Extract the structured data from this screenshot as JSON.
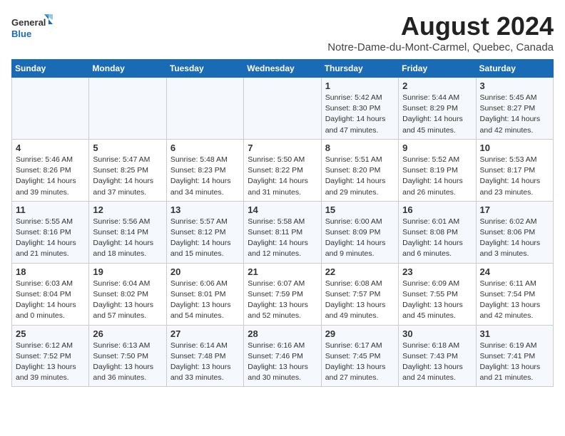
{
  "logo": {
    "line1": "General",
    "line2": "Blue"
  },
  "title": "August 2024",
  "subtitle": "Notre-Dame-du-Mont-Carmel, Quebec, Canada",
  "days_of_week": [
    "Sunday",
    "Monday",
    "Tuesday",
    "Wednesday",
    "Thursday",
    "Friday",
    "Saturday"
  ],
  "weeks": [
    [
      {
        "day": "",
        "info": ""
      },
      {
        "day": "",
        "info": ""
      },
      {
        "day": "",
        "info": ""
      },
      {
        "day": "",
        "info": ""
      },
      {
        "day": "1",
        "info": "Sunrise: 5:42 AM\nSunset: 8:30 PM\nDaylight: 14 hours\nand 47 minutes."
      },
      {
        "day": "2",
        "info": "Sunrise: 5:44 AM\nSunset: 8:29 PM\nDaylight: 14 hours\nand 45 minutes."
      },
      {
        "day": "3",
        "info": "Sunrise: 5:45 AM\nSunset: 8:27 PM\nDaylight: 14 hours\nand 42 minutes."
      }
    ],
    [
      {
        "day": "4",
        "info": "Sunrise: 5:46 AM\nSunset: 8:26 PM\nDaylight: 14 hours\nand 39 minutes."
      },
      {
        "day": "5",
        "info": "Sunrise: 5:47 AM\nSunset: 8:25 PM\nDaylight: 14 hours\nand 37 minutes."
      },
      {
        "day": "6",
        "info": "Sunrise: 5:48 AM\nSunset: 8:23 PM\nDaylight: 14 hours\nand 34 minutes."
      },
      {
        "day": "7",
        "info": "Sunrise: 5:50 AM\nSunset: 8:22 PM\nDaylight: 14 hours\nand 31 minutes."
      },
      {
        "day": "8",
        "info": "Sunrise: 5:51 AM\nSunset: 8:20 PM\nDaylight: 14 hours\nand 29 minutes."
      },
      {
        "day": "9",
        "info": "Sunrise: 5:52 AM\nSunset: 8:19 PM\nDaylight: 14 hours\nand 26 minutes."
      },
      {
        "day": "10",
        "info": "Sunrise: 5:53 AM\nSunset: 8:17 PM\nDaylight: 14 hours\nand 23 minutes."
      }
    ],
    [
      {
        "day": "11",
        "info": "Sunrise: 5:55 AM\nSunset: 8:16 PM\nDaylight: 14 hours\nand 21 minutes."
      },
      {
        "day": "12",
        "info": "Sunrise: 5:56 AM\nSunset: 8:14 PM\nDaylight: 14 hours\nand 18 minutes."
      },
      {
        "day": "13",
        "info": "Sunrise: 5:57 AM\nSunset: 8:12 PM\nDaylight: 14 hours\nand 15 minutes."
      },
      {
        "day": "14",
        "info": "Sunrise: 5:58 AM\nSunset: 8:11 PM\nDaylight: 14 hours\nand 12 minutes."
      },
      {
        "day": "15",
        "info": "Sunrise: 6:00 AM\nSunset: 8:09 PM\nDaylight: 14 hours\nand 9 minutes."
      },
      {
        "day": "16",
        "info": "Sunrise: 6:01 AM\nSunset: 8:08 PM\nDaylight: 14 hours\nand 6 minutes."
      },
      {
        "day": "17",
        "info": "Sunrise: 6:02 AM\nSunset: 8:06 PM\nDaylight: 14 hours\nand 3 minutes."
      }
    ],
    [
      {
        "day": "18",
        "info": "Sunrise: 6:03 AM\nSunset: 8:04 PM\nDaylight: 14 hours\nand 0 minutes."
      },
      {
        "day": "19",
        "info": "Sunrise: 6:04 AM\nSunset: 8:02 PM\nDaylight: 13 hours\nand 57 minutes."
      },
      {
        "day": "20",
        "info": "Sunrise: 6:06 AM\nSunset: 8:01 PM\nDaylight: 13 hours\nand 54 minutes."
      },
      {
        "day": "21",
        "info": "Sunrise: 6:07 AM\nSunset: 7:59 PM\nDaylight: 13 hours\nand 52 minutes."
      },
      {
        "day": "22",
        "info": "Sunrise: 6:08 AM\nSunset: 7:57 PM\nDaylight: 13 hours\nand 49 minutes."
      },
      {
        "day": "23",
        "info": "Sunrise: 6:09 AM\nSunset: 7:55 PM\nDaylight: 13 hours\nand 45 minutes."
      },
      {
        "day": "24",
        "info": "Sunrise: 6:11 AM\nSunset: 7:54 PM\nDaylight: 13 hours\nand 42 minutes."
      }
    ],
    [
      {
        "day": "25",
        "info": "Sunrise: 6:12 AM\nSunset: 7:52 PM\nDaylight: 13 hours\nand 39 minutes."
      },
      {
        "day": "26",
        "info": "Sunrise: 6:13 AM\nSunset: 7:50 PM\nDaylight: 13 hours\nand 36 minutes."
      },
      {
        "day": "27",
        "info": "Sunrise: 6:14 AM\nSunset: 7:48 PM\nDaylight: 13 hours\nand 33 minutes."
      },
      {
        "day": "28",
        "info": "Sunrise: 6:16 AM\nSunset: 7:46 PM\nDaylight: 13 hours\nand 30 minutes."
      },
      {
        "day": "29",
        "info": "Sunrise: 6:17 AM\nSunset: 7:45 PM\nDaylight: 13 hours\nand 27 minutes."
      },
      {
        "day": "30",
        "info": "Sunrise: 6:18 AM\nSunset: 7:43 PM\nDaylight: 13 hours\nand 24 minutes."
      },
      {
        "day": "31",
        "info": "Sunrise: 6:19 AM\nSunset: 7:41 PM\nDaylight: 13 hours\nand 21 minutes."
      }
    ]
  ]
}
